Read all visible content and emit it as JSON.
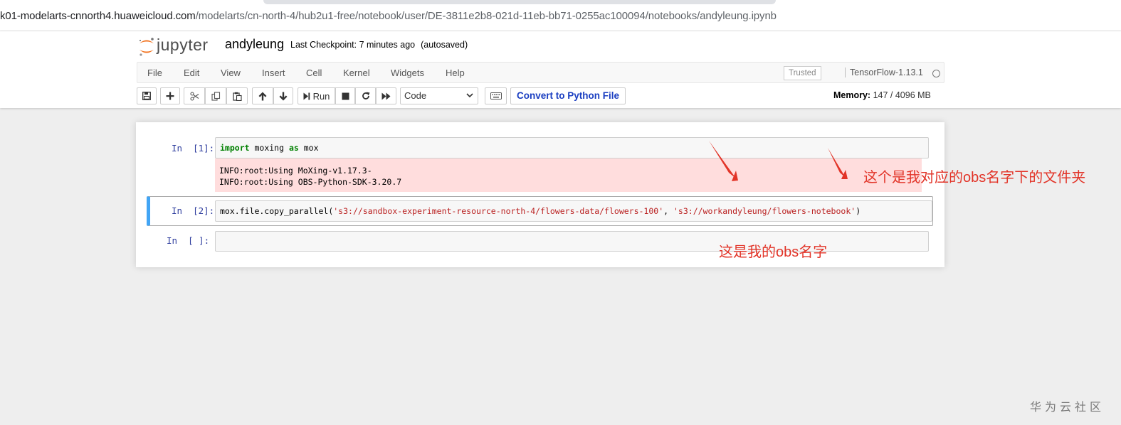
{
  "browser": {
    "url_host": "k01-modelarts-cnnorth4.huaweicloud.com",
    "url_path": "/modelarts/cn-north-4/hub2u1-free/notebook/user/DE-3811e2b8-021d-11eb-bb71-0255ac100094/notebooks/andyleung.ipynb"
  },
  "header": {
    "logo_text": "jupyter",
    "notebook_name": "andyleung",
    "checkpoint": "Last Checkpoint: 7 minutes ago",
    "autosaved": "(autosaved)"
  },
  "menu": {
    "items": [
      "File",
      "Edit",
      "View",
      "Insert",
      "Cell",
      "Kernel",
      "Widgets",
      "Help"
    ],
    "trusted": "Trusted",
    "kernel": "TensorFlow-1.13.1"
  },
  "toolbar": {
    "run_label": "Run",
    "cell_type": "Code",
    "convert_label": "Convert to Python File",
    "memory_label": "Memory:",
    "memory_value": "147 / 4096 MB"
  },
  "cells": [
    {
      "prompt": "In  [1]:",
      "code": {
        "kw1": "import",
        "mid": " moxing ",
        "kw2": "as",
        "end": " mox"
      },
      "output": "INFO:root:Using MoXing-v1.17.3-\nINFO:root:Using OBS-Python-SDK-3.20.7"
    },
    {
      "prompt": "In  [2]:",
      "code": {
        "fn": "mox.file.copy_parallel(",
        "arg1": "'s3://sandbox-experiment-resource-north-4/flowers-data/flowers-100'",
        "sep": ", ",
        "arg2": "'s3://workandyleung/flowers-notebook'",
        "close": ")"
      }
    },
    {
      "prompt": "In  [ ]:"
    }
  ],
  "annotations": {
    "folder_note": "这个是我对应的obs名字下的文件夹",
    "name_note": "这是我的obs名字",
    "color": "#e23428"
  },
  "watermark": "华为云社区",
  "colors": {
    "selected_cell_bar": "#42a5f5",
    "output_bg": "#ffdddd",
    "keyword": "#008000",
    "string": "#ba2121"
  }
}
